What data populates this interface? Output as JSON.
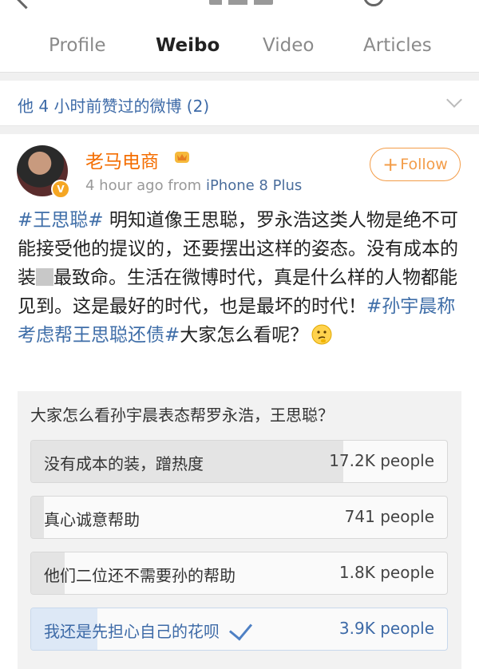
{
  "tabs": [
    {
      "label": "Profile"
    },
    {
      "label": "Weibo"
    },
    {
      "label": "Video"
    },
    {
      "label": "Articles"
    }
  ],
  "liked_bar": {
    "text": "他 4 小时前赞过的微博 (2)"
  },
  "post": {
    "username": "老马电商",
    "time": "4 hour ago",
    "from_label": "from",
    "source": "iPhone 8 Plus",
    "follow_label": "Follow",
    "badge": "V",
    "body": {
      "tag1": "#王思聪#",
      "t1": " 明知道像王思聪，罗永浩这类人物是绝不可能接受他的提议的，还要摆出这样的姿态。没有成本的装",
      "t2": "最致命。生活在微博时代，真是什么样的人物都能见到。这是最好的时代，也是最坏的时代！",
      "tag2": "#孙宇晨称考虑帮王思聪还债#",
      "t3": "大家怎么看呢？"
    }
  },
  "poll": {
    "question": "大家怎么看孙宇晨表态帮罗永浩，王思聪？",
    "options": [
      {
        "label": "没有成本的装，蹭热度",
        "count": "17.2K people",
        "share": 0.75,
        "selected": false
      },
      {
        "label": "真心诚意帮助",
        "count": "741 people",
        "share": 0.03,
        "selected": false
      },
      {
        "label": "他们二位还不需要孙的帮助",
        "count": "1.8K people",
        "share": 0.08,
        "selected": false
      },
      {
        "label": "我还是先担心自己的花呗",
        "count": "3.9K people",
        "share": 0.16,
        "selected": true
      }
    ]
  },
  "icons": [
    "back-arrow-icon",
    "search-icon",
    "chevron-down-icon",
    "crown-icon",
    "verified-badge-icon",
    "thinking-emoji-icon",
    "checkmark-icon"
  ],
  "colors": {
    "accent": "#f39c48",
    "link": "#3f6ea8",
    "username": "#f46d00"
  }
}
